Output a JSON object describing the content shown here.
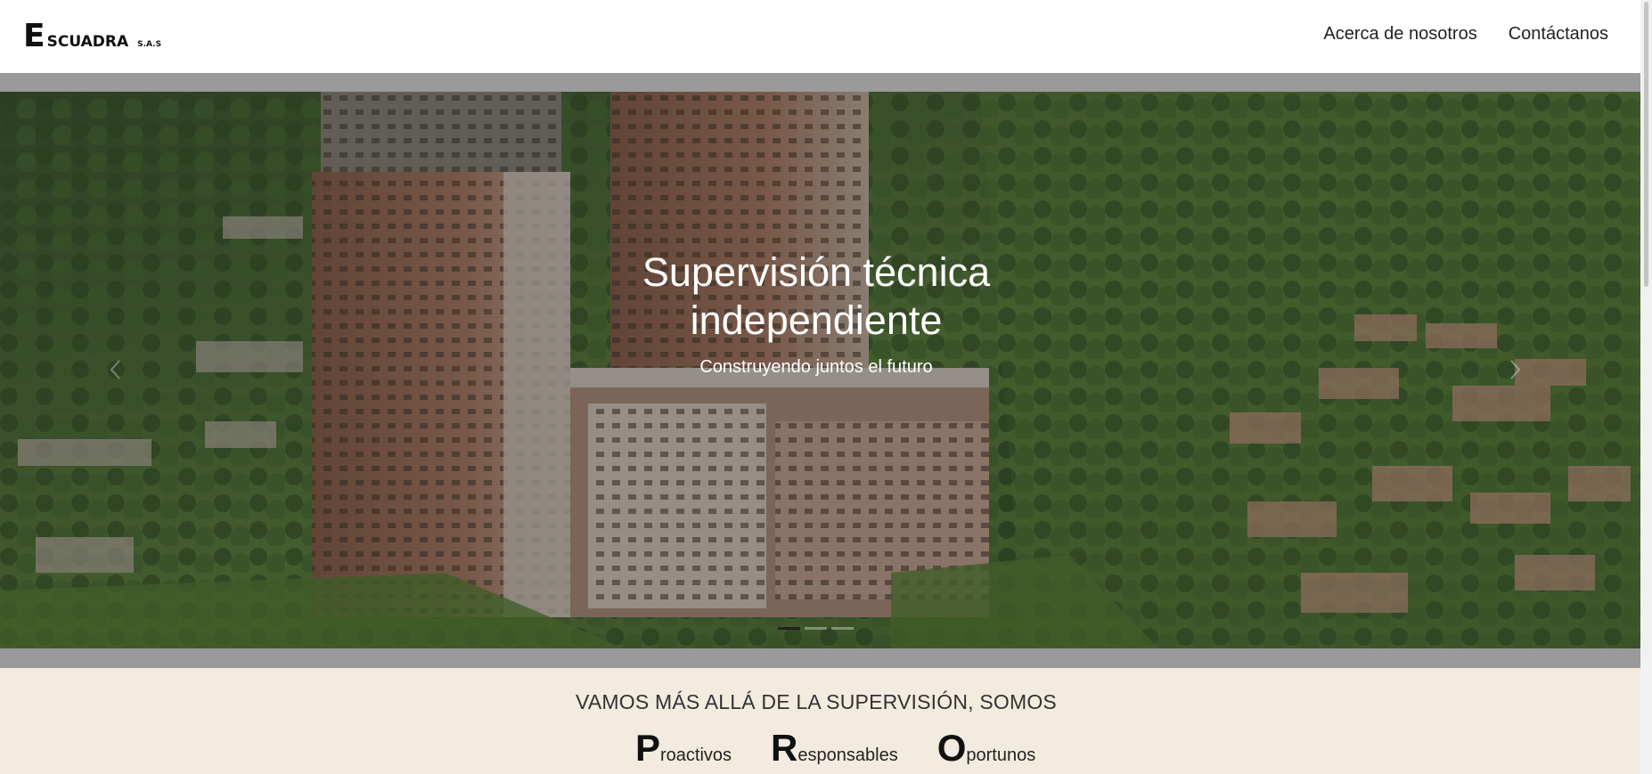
{
  "brand": {
    "initial": "E",
    "rest": "SCUADRA",
    "suffix": "S.A.S"
  },
  "nav": {
    "items": [
      {
        "label": "Acerca de nosotros"
      },
      {
        "label": "Contáctanos"
      }
    ]
  },
  "hero": {
    "title": "Supervisión técnica independiente",
    "subtitle": "Construyendo juntos el futuro",
    "prev_icon": "chevron-left-icon",
    "next_icon": "chevron-right-icon",
    "slides_count": 3,
    "active_slide": 1
  },
  "pro": {
    "heading": "VAMOS MÁS ALLÁ DE LA SUPERVISIÓN, SOMOS",
    "words": [
      {
        "initial": "P",
        "rest": "roactivos"
      },
      {
        "initial": "R",
        "rest": "esponsables"
      },
      {
        "initial": "O",
        "rest": "portunos"
      }
    ]
  },
  "colors": {
    "nav_bg": "#ffffff",
    "carousel_frame": "#9a9a9a",
    "pro_bg": "#f4ebe0"
  }
}
